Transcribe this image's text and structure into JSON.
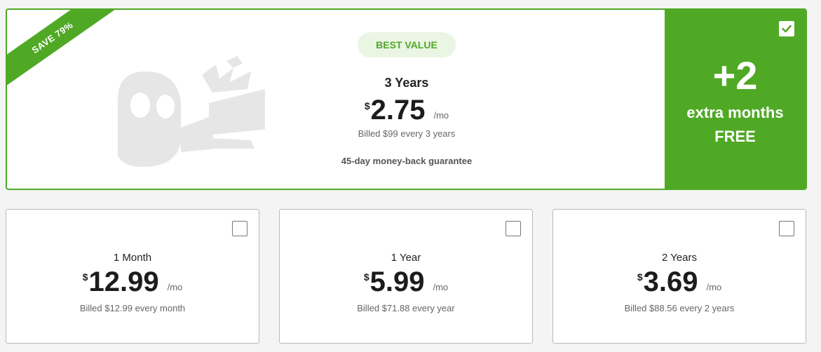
{
  "featured": {
    "ribbon": "SAVE 79%",
    "badge": "BEST VALUE",
    "title": "3 Years",
    "currency": "$",
    "price": "2.75",
    "per": "/mo",
    "billed": "Billed $99 every 3 years",
    "guarantee": "45-day money-back guarantee",
    "selected": true,
    "bonus_big": "+2",
    "bonus_line1": "extra months",
    "bonus_line2": "FREE"
  },
  "plans": [
    {
      "title": "1 Month",
      "currency": "$",
      "price": "12.99",
      "per": "/mo",
      "billed": "Billed $12.99 every month",
      "selected": false
    },
    {
      "title": "1 Year",
      "currency": "$",
      "price": "5.99",
      "per": "/mo",
      "billed": "Billed $71.88 every year",
      "selected": false
    },
    {
      "title": "2 Years",
      "currency": "$",
      "price": "3.69",
      "per": "/mo",
      "billed": "Billed $88.56 every 2 years",
      "selected": false
    }
  ],
  "colors": {
    "accent": "#4fa925",
    "badge_bg": "#eaf5e4",
    "ghost": "#e6e6e6"
  },
  "icons": {
    "mascot": "ghost-mascot-icon",
    "checked": "checkbox-checked-icon",
    "unchecked": "checkbox-unchecked-icon"
  }
}
